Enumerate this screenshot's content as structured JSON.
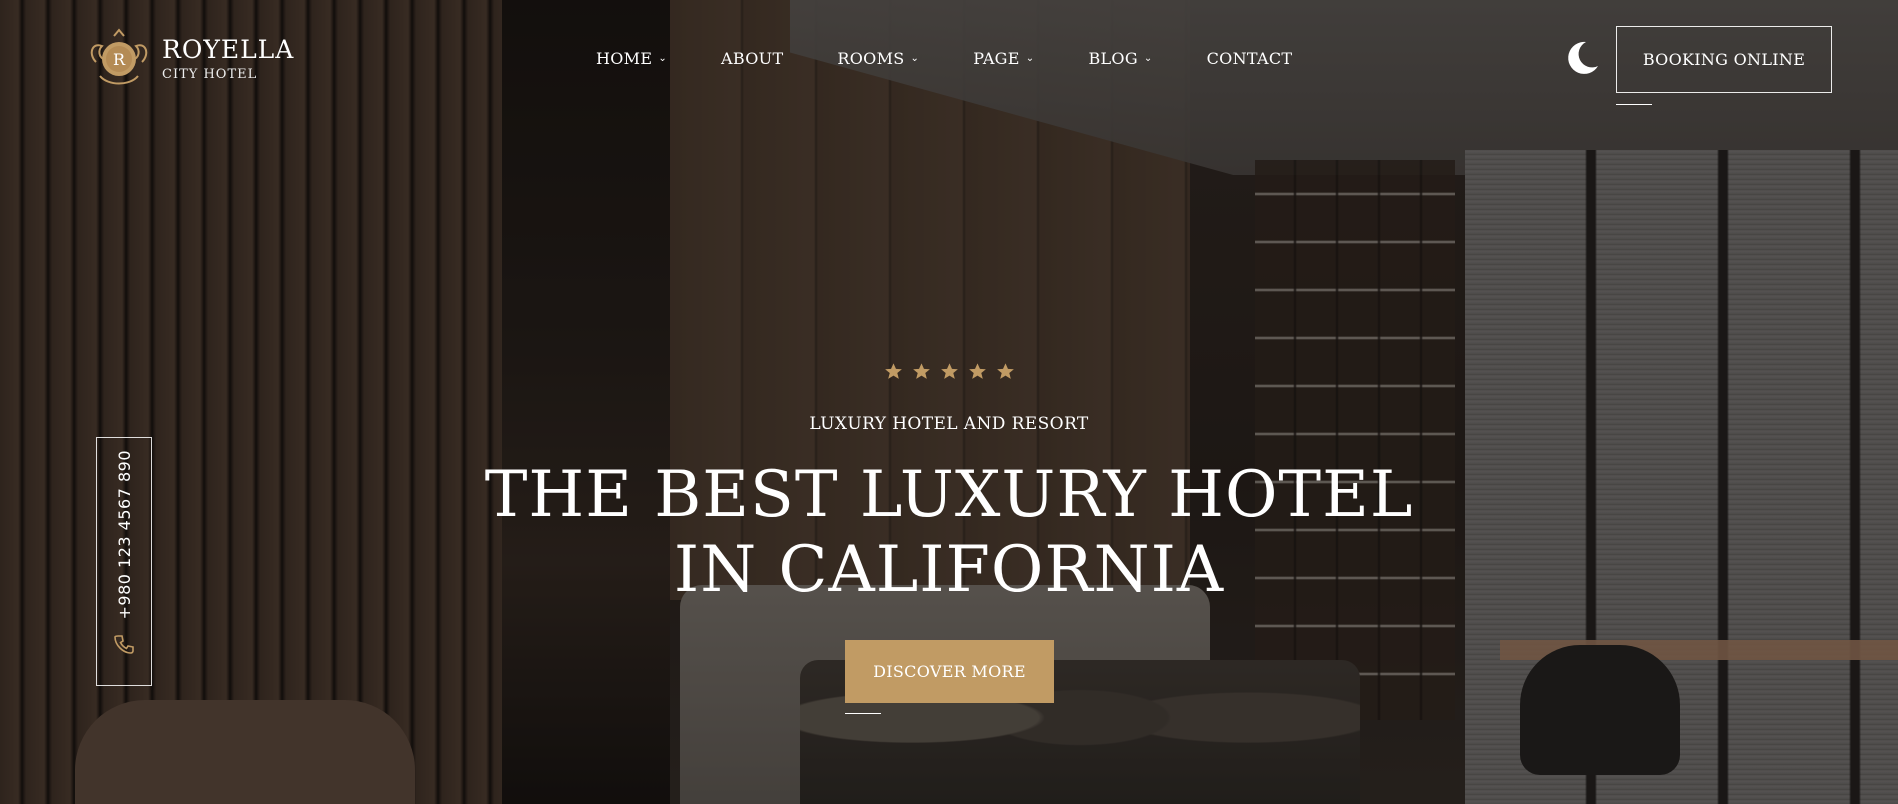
{
  "brand": {
    "logo_letter": "R",
    "name": "ROYELLA",
    "subtitle": "CITY HOTEL",
    "accent_color": "#c19b64"
  },
  "nav": {
    "items": [
      {
        "label": "HOME",
        "has_dropdown": true
      },
      {
        "label": "ABOUT",
        "has_dropdown": false
      },
      {
        "label": "ROOMS",
        "has_dropdown": true
      },
      {
        "label": "PAGE",
        "has_dropdown": true
      },
      {
        "label": "BLOG",
        "has_dropdown": true
      },
      {
        "label": "CONTACT",
        "has_dropdown": false
      }
    ],
    "chevron": "⌄"
  },
  "header": {
    "theme_toggle_icon": "moon-icon",
    "booking_label": "BOOKING ONLINE"
  },
  "side_contact": {
    "phone": "+980 123 4567 890",
    "icon": "phone-icon"
  },
  "hero": {
    "rating": 5,
    "rating_max": 5,
    "tagline": "LUXURY HOTEL AND RESORT",
    "headline_line1": "THE BEST LUXURY HOTEL",
    "headline_line2": "IN CALIFORNIA",
    "cta_label": "DISCOVER MORE"
  }
}
